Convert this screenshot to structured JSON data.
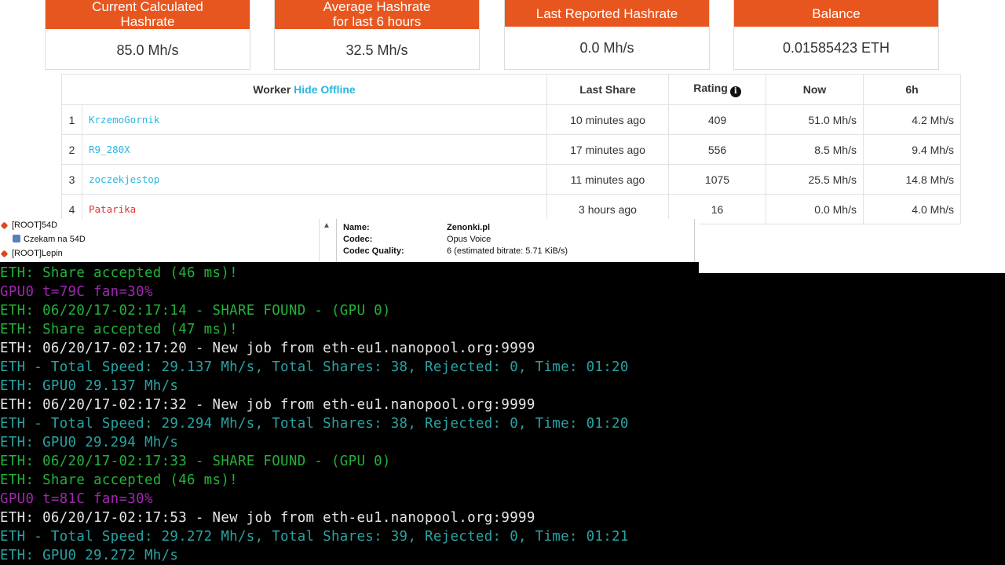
{
  "stats": [
    {
      "title_lines": [
        "Current Calculated",
        "Hashrate"
      ],
      "value": "85.0 Mh/s"
    },
    {
      "title_lines": [
        "Average Hashrate",
        "for last 6 hours"
      ],
      "value": "32.5 Mh/s"
    },
    {
      "title_lines": [
        "Last Reported Hashrate"
      ],
      "value": "0.0 Mh/s"
    },
    {
      "title_lines": [
        "Balance"
      ],
      "value": "0.01585423 ETH"
    }
  ],
  "workers": {
    "header": {
      "worker": "Worker",
      "hide_offline": "Hide Offline",
      "last_share": "Last Share",
      "rating": "Rating",
      "now": "Now",
      "h6": "6h"
    },
    "rows": [
      {
        "index": "1",
        "name": "KrzemoGornik",
        "last_share": "10 minutes ago",
        "rating": "409",
        "now": "51.0 Mh/s",
        "h6": "4.2 Mh/s",
        "offline": false
      },
      {
        "index": "2",
        "name": "R9_280X",
        "last_share": "17 minutes ago",
        "rating": "556",
        "now": "8.5 Mh/s",
        "h6": "9.4 Mh/s",
        "offline": false
      },
      {
        "index": "3",
        "name": "zoczekjestop",
        "last_share": "11 minutes ago",
        "rating": "1075",
        "now": "25.5 Mh/s",
        "h6": "14.8 Mh/s",
        "offline": false
      },
      {
        "index": "4",
        "name": "Patarika",
        "last_share": "3 hours ago",
        "rating": "16",
        "now": "0.0 Mh/s",
        "h6": "4.0 Mh/s",
        "offline": true
      }
    ]
  },
  "teamspeak": {
    "tree": [
      {
        "label": "[ROOT]54D",
        "icon": "channel-icon"
      },
      {
        "label": "Czekam na 54D",
        "icon": "user-icon"
      },
      {
        "label": "[ROOT]Lepin",
        "icon": "channel-icon"
      }
    ],
    "info": [
      {
        "label": "Name:",
        "value": "Zenonki.pl"
      },
      {
        "label": "Codec:",
        "value": "Opus Voice"
      },
      {
        "label": "Codec Quality:",
        "value": "6 (estimated bitrate: 5.71 KiB/s)"
      }
    ]
  },
  "console": {
    "lines": [
      {
        "text": "ETH: Share accepted (46 ms)!",
        "color": "green"
      },
      {
        "text": "GPU0 t=79C fan=30%",
        "color": "magenta"
      },
      {
        "text": "ETH: 06/20/17-02:17:14 - SHARE FOUND - (GPU 0)",
        "color": "green"
      },
      {
        "text": "ETH: Share accepted (47 ms)!",
        "color": "green"
      },
      {
        "text": "ETH: 06/20/17-02:17:20 - New job from eth-eu1.nanopool.org:9999",
        "color": "white"
      },
      {
        "text": "ETH - Total Speed: 29.137 Mh/s, Total Shares: 38, Rejected: 0, Time: 01:20",
        "color": "cyan"
      },
      {
        "text": "ETH: GPU0 29.137 Mh/s",
        "color": "cyan"
      },
      {
        "text": "ETH: 06/20/17-02:17:32 - New job from eth-eu1.nanopool.org:9999",
        "color": "white"
      },
      {
        "text": "ETH - Total Speed: 29.294 Mh/s, Total Shares: 38, Rejected: 0, Time: 01:20",
        "color": "cyan"
      },
      {
        "text": "ETH: GPU0 29.294 Mh/s",
        "color": "cyan"
      },
      {
        "text": "ETH: 06/20/17-02:17:33 - SHARE FOUND - (GPU 0)",
        "color": "green"
      },
      {
        "text": "ETH: Share accepted (46 ms)!",
        "color": "green"
      },
      {
        "text": "GPU0 t=81C fan=30%",
        "color": "magenta"
      },
      {
        "text": "ETH: 06/20/17-02:17:53 - New job from eth-eu1.nanopool.org:9999",
        "color": "white"
      },
      {
        "text": "ETH - Total Speed: 29.272 Mh/s, Total Shares: 39, Rejected: 0, Time: 01:21",
        "color": "cyan"
      },
      {
        "text": "ETH: GPU0 29.272 Mh/s",
        "color": "cyan"
      }
    ]
  },
  "colors": {
    "accent": "#e8561f",
    "link": "#29b6e0",
    "offline": "#e3342f"
  }
}
